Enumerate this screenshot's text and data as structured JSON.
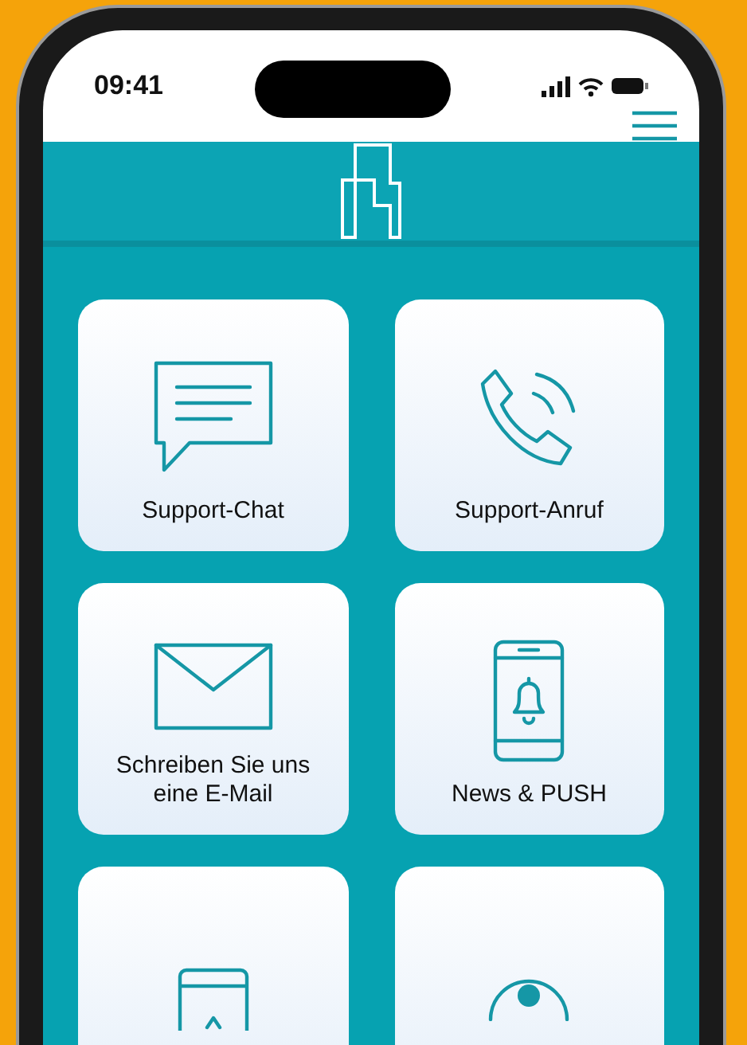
{
  "status_bar": {
    "time": "09:41"
  },
  "tiles": [
    {
      "kind": "chat",
      "label": "Support-Chat"
    },
    {
      "kind": "phone",
      "label": "Support-Anruf"
    },
    {
      "kind": "mail",
      "label": "Schreiben Sie uns eine E-Mail"
    },
    {
      "kind": "notification",
      "label": "News & PUSH"
    },
    {
      "kind": "tablet"
    },
    {
      "kind": "location"
    }
  ]
}
